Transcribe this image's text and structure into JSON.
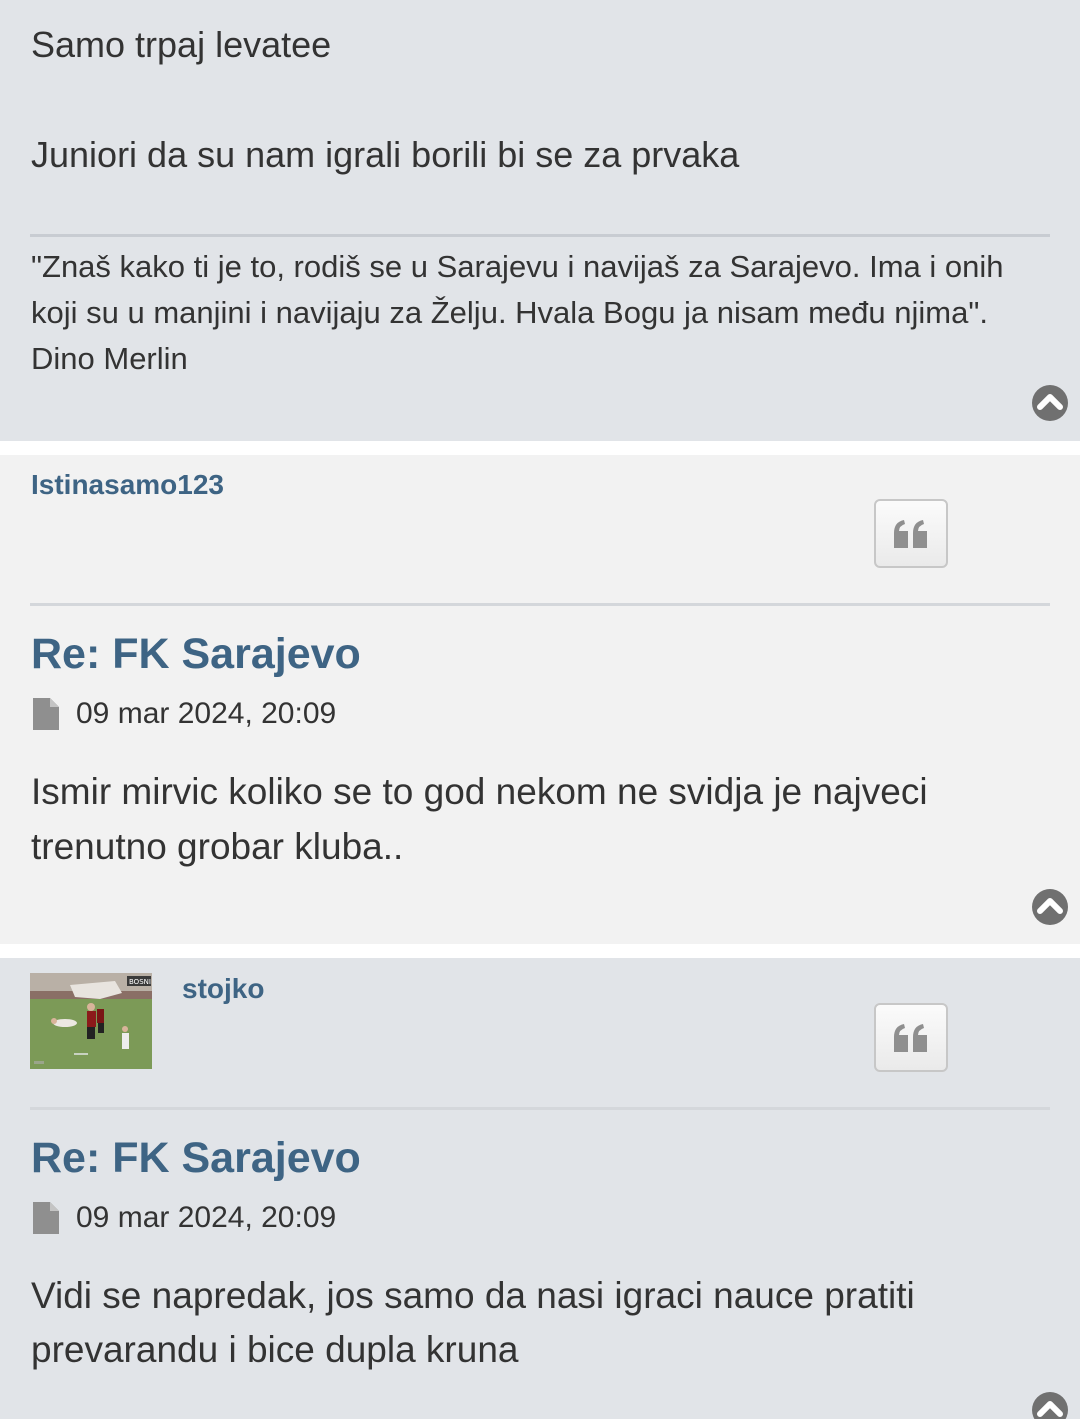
{
  "posts": [
    {
      "content_lines": [
        "Samo trpaj levatee",
        "Juniori da su nam igrali borili bi se za prvaka"
      ],
      "signature_lines": [
        "\"Znaš kako ti je to, rodiš se u Sarajevu i navijaš za Sarajevo. Ima i onih",
        "koji su u manjini i navijaju za Želju. Hvala Bogu ja nisam među njima\".",
        "Dino Merlin"
      ],
      "top_icon": "chevron-up-circle-icon"
    },
    {
      "username": "Istinasamo123",
      "quote_icon": "quote-icon",
      "title": "Re: FK Sarajevo",
      "date_icon": "file-icon",
      "date": "09 mar 2024, 20:09",
      "body_lines": [
        "Ismir mirvic koliko se to god nekom ne svidja je najveci",
        "trenutno grobar kluba.."
      ],
      "top_icon": "chevron-up-circle-icon"
    },
    {
      "username": "stojko",
      "avatar": "football-match-photo",
      "avatar_text": "BOSNI",
      "quote_icon": "quote-icon",
      "title": "Re: FK Sarajevo",
      "date_icon": "file-icon",
      "date": "09 mar 2024, 20:09",
      "body_lines": [
        "Vidi se napredak, jos samo da nasi igraci nauce pratiti",
        "prevarandu i bice dupla kruna"
      ],
      "top_icon": "chevron-up-circle-icon"
    }
  ],
  "colors": {
    "link_blue": "#3e6484",
    "bg_alt1": "#e1e4e8",
    "bg_alt2": "#f2f2f2",
    "icon_gray": "#8f8f8f",
    "top_button": "#707070"
  }
}
